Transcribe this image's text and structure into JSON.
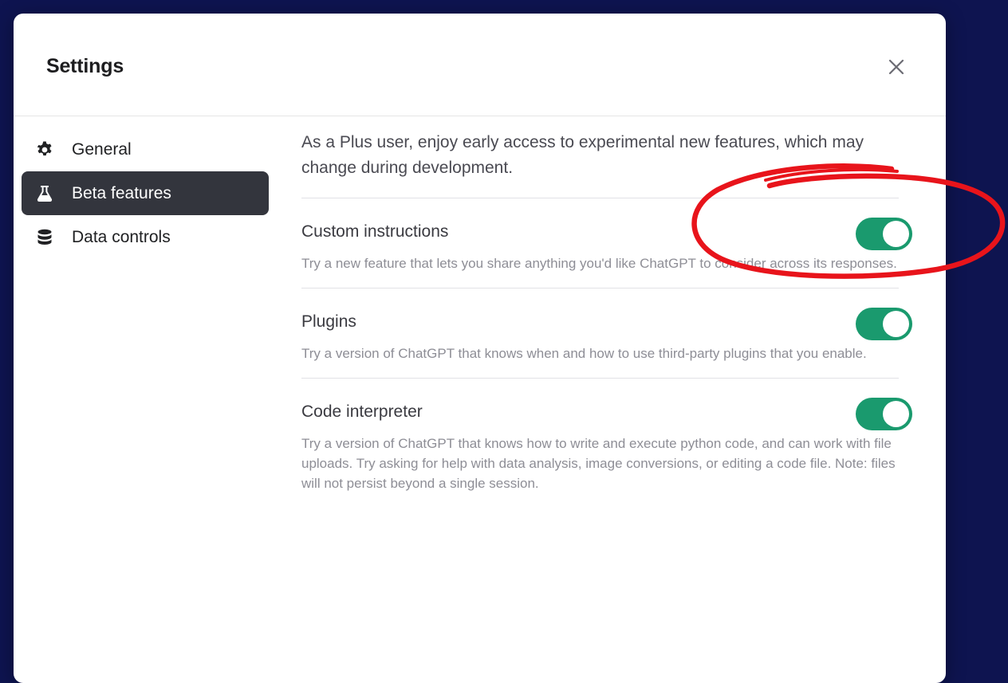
{
  "modal": {
    "title": "Settings",
    "close_icon": "close-icon"
  },
  "sidebar": {
    "items": [
      {
        "label": "General",
        "icon": "gear-icon",
        "active": false
      },
      {
        "label": "Beta features",
        "icon": "flask-icon",
        "active": true
      },
      {
        "label": "Data controls",
        "icon": "database-icon",
        "active": false
      }
    ]
  },
  "content": {
    "intro": "As a Plus user, enjoy early access to experimental new features, which may change during development.",
    "features": [
      {
        "title": "Custom instructions",
        "description": "Try a new feature that lets you share anything you'd like ChatGPT to consider across its responses.",
        "enabled": true
      },
      {
        "title": "Plugins",
        "description": "Try a version of ChatGPT that knows when and how to use third-party plugins that you enable.",
        "enabled": true
      },
      {
        "title": "Code interpreter",
        "description": "Try a version of ChatGPT that knows how to write and execute python code, and can work with file uploads. Try asking for help with data analysis, image conversions, or editing a code file. Note: files will not persist beyond a single session.",
        "enabled": true
      }
    ]
  },
  "colors": {
    "background": "#0e1450",
    "toggle_on": "#1a9a6e",
    "active_nav": "#33353d",
    "annotation": "#e8141b"
  }
}
